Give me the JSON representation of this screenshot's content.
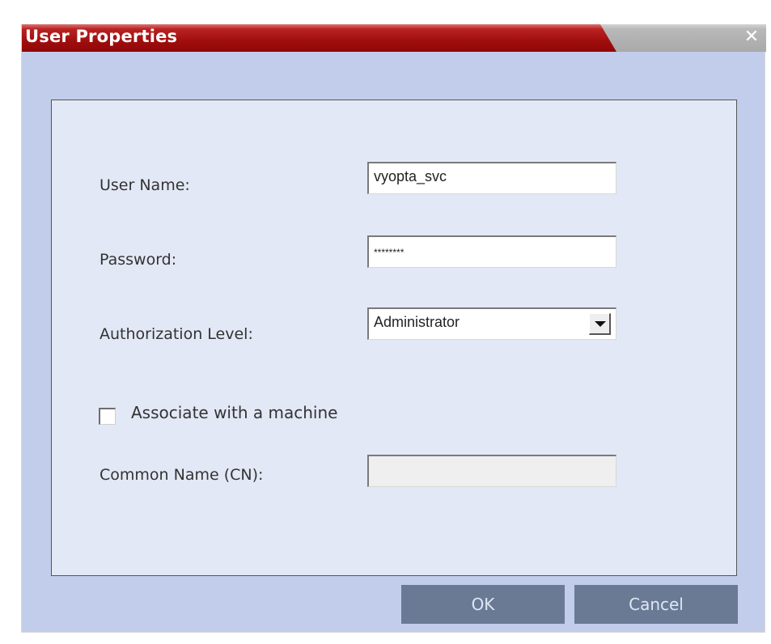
{
  "dialog": {
    "title": "User Properties",
    "close_glyph": "✕",
    "close_icon": "close-icon"
  },
  "form": {
    "user_name": {
      "label": "User Name:",
      "value": "vyopta_svc"
    },
    "password": {
      "label": "Password:",
      "value": "********"
    },
    "authorization_level": {
      "label": "Authorization Level:",
      "selected": "Administrator"
    },
    "associate_machine": {
      "label": "Associate with a machine",
      "checked": false
    },
    "common_name": {
      "label": "Common Name (CN):",
      "value": "",
      "disabled": true
    }
  },
  "buttons": {
    "ok_label": "OK",
    "cancel_label": "Cancel"
  },
  "colors": {
    "title_red": "#a10e0e",
    "dialog_bg": "#c1cdea",
    "panel_bg": "#e3e8f6",
    "button_bg": "#6a7a95"
  }
}
